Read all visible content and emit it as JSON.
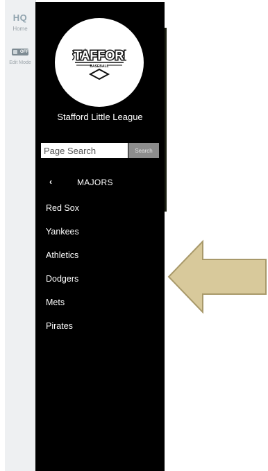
{
  "rail": {
    "brand": "HQ",
    "brand_sub": "Home",
    "toggle_state": "OFF",
    "toggle_label": "Edit Mode"
  },
  "sidebar": {
    "logo": {
      "word": "STAFFORD",
      "sub": "BASEBALL"
    },
    "team_name": "Stafford Little League",
    "search": {
      "placeholder": "Page Search",
      "button": "Search"
    },
    "section": {
      "back_icon": "chevron-left-icon",
      "title": "MAJORS"
    },
    "teams": [
      {
        "label": "Red Sox"
      },
      {
        "label": "Yankees"
      },
      {
        "label": "Athletics"
      },
      {
        "label": "Dodgers"
      },
      {
        "label": "Mets"
      },
      {
        "label": "Pirates"
      }
    ]
  },
  "colors": {
    "sidebar_bg": "#000000",
    "rail_bg": "#eef0f2",
    "arrow_fill": "#d8c99b",
    "arrow_stroke": "#a8996a"
  }
}
